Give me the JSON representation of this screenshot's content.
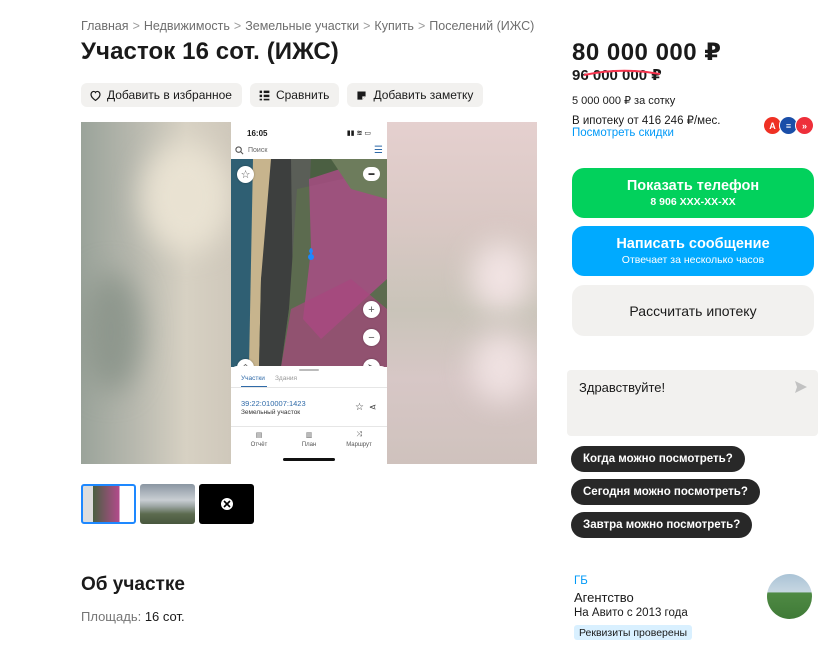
{
  "breadcrumbs": [
    "Главная",
    "Недвижимость",
    "Земельные участки",
    "Купить",
    "Поселений (ИЖС)"
  ],
  "breadcrumb_separator": ">",
  "title": "Участок 16 сот. (ИЖС)",
  "actions": {
    "favorite": "Добавить в избранное",
    "compare": "Сравнить",
    "note": "Добавить заметку"
  },
  "gallery": {
    "phone_screenshot": {
      "time": "16:05",
      "search_placeholder": "Поиск",
      "tabs": [
        "Участки",
        "Здания"
      ],
      "cadastral_number": "39:22:010007:1423",
      "object_type": "Земельный участок",
      "bottom_nav": [
        "Отчёт",
        "План",
        "Маршрут"
      ]
    },
    "thumbnails_count": 3
  },
  "about": {
    "heading": "Об участке",
    "area_label": "Площадь:",
    "area_value": "16 сот."
  },
  "pricing": {
    "price": "80 000 000 ₽",
    "old_price": "96 000 000 ₽",
    "per_sotka": "5 000 000 ₽ за сотку",
    "mortgage": "В ипотеку от 416 246 ₽/мес.",
    "discounts_link": "Посмотреть скидки"
  },
  "contact": {
    "show_phone": "Показать телефон",
    "phone_masked": "8 906 XXX-XX-XX",
    "write_message": "Написать сообщение",
    "reply_time": "Отвечает за несколько часов",
    "calc_mortgage": "Рассчитать ипотеку"
  },
  "chat": {
    "message": "Здравствуйте!",
    "quick_replies": [
      "Когда можно посмотреть?",
      "Сегодня можно посмотреть?",
      "Завтра можно посмотреть?"
    ]
  },
  "seller": {
    "name": "ГБ",
    "type": "Агентство",
    "since": "На Авито с 2013 года",
    "badge": "Реквизиты проверены"
  },
  "colors": {
    "green": "#02d15c",
    "blue": "#00aaff",
    "link": "#0099f7",
    "dark_chip": "#282828"
  }
}
